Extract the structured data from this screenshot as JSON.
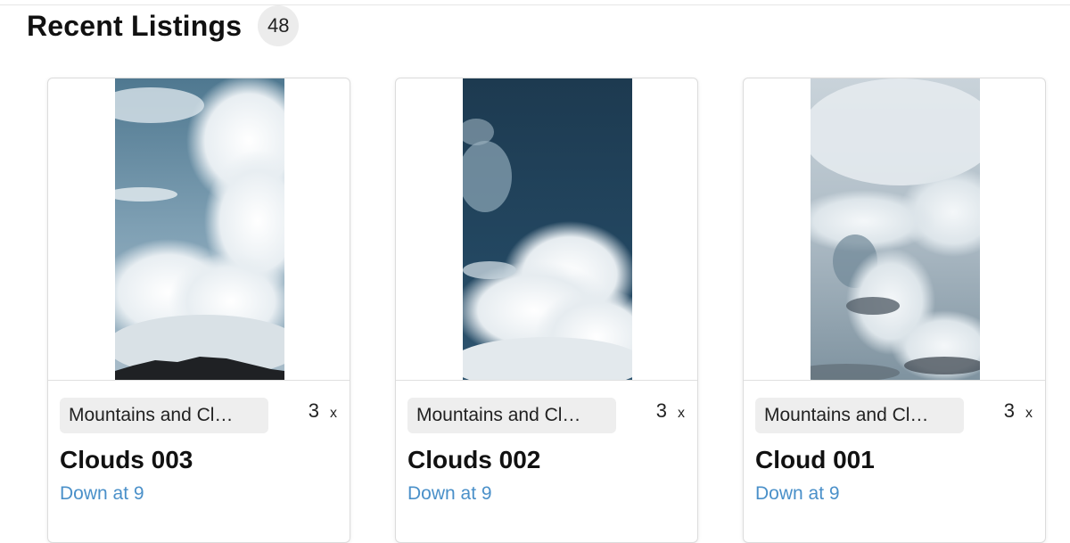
{
  "section": {
    "title": "Recent Listings",
    "count": "48"
  },
  "listings": [
    {
      "collection": "Mountains and Cl…",
      "quantity": "3",
      "quantity_suffix": "x",
      "title": "Clouds 003",
      "status": "Down at 9",
      "image": "clouds-over-mountain-image"
    },
    {
      "collection": "Mountains and Cl…",
      "quantity": "3",
      "quantity_suffix": "x",
      "title": "Clouds 002",
      "status": "Down at 9",
      "image": "cumulus-clouds-dark-sky-image"
    },
    {
      "collection": "Mountains and Cl…",
      "quantity": "3",
      "quantity_suffix": "x",
      "title": "Cloud 001",
      "status": "Down at 9",
      "image": "overcast-clouds-image"
    }
  ],
  "colors": {
    "link": "#4a90c9",
    "chip_bg": "#eeeeee",
    "badge_bg": "#ececec"
  }
}
